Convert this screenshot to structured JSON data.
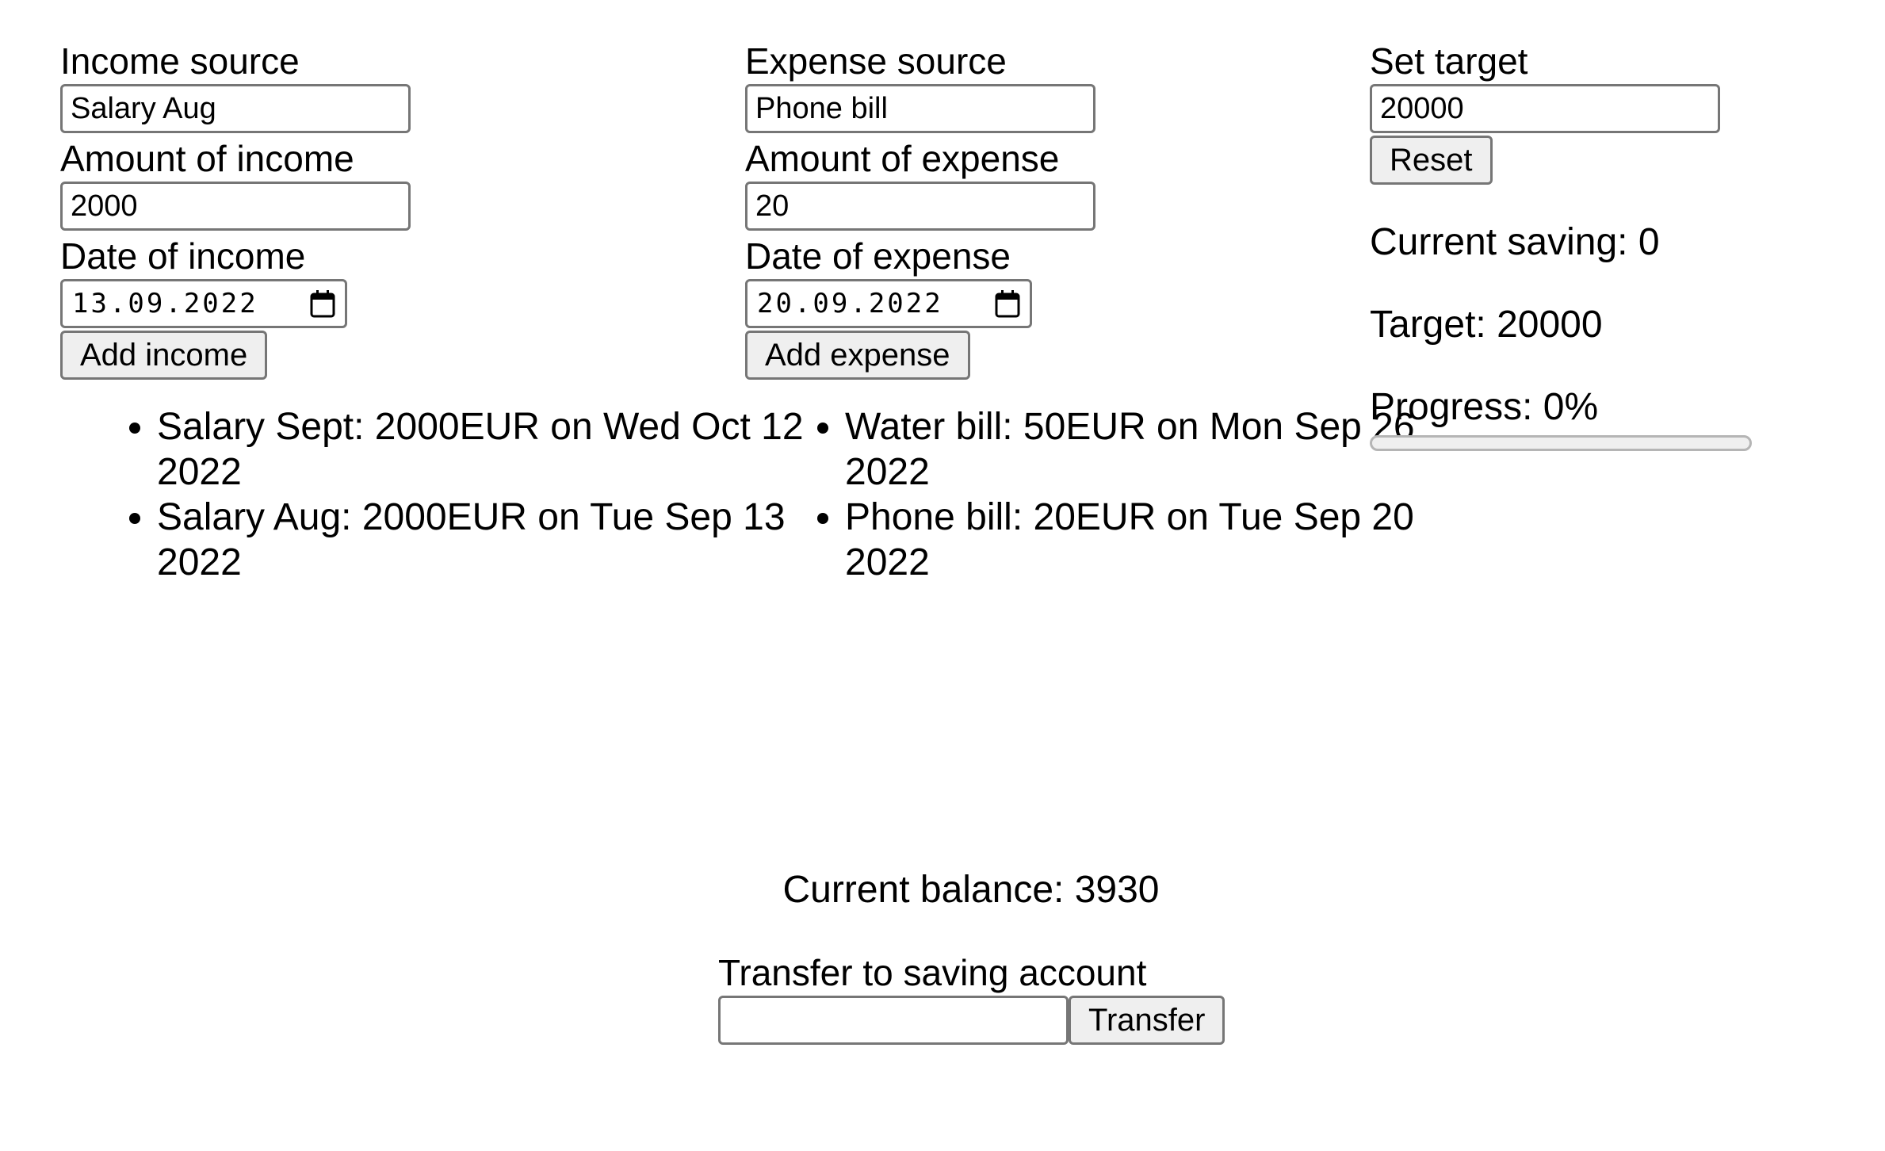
{
  "income": {
    "source_label": "Income source",
    "source_value": "Salary Aug",
    "amount_label": "Amount of income",
    "amount_value": "2000",
    "date_label": "Date of income",
    "date_value": "13.09.2022",
    "add_label": "Add income",
    "entries": [
      "Salary Sept: 2000EUR on Wed Oct 12 2022",
      "Salary Aug: 2000EUR on Tue Sep 13 2022"
    ]
  },
  "expense": {
    "source_label": "Expense source",
    "source_value": "Phone bill",
    "amount_label": "Amount of expense",
    "amount_value": "20",
    "date_label": "Date of expense",
    "date_value": "20.09.2022",
    "add_label": "Add expense",
    "entries": [
      "Water bill: 50EUR on Mon Sep 26 2022",
      "Phone bill: 20EUR on Tue Sep 20 2022"
    ]
  },
  "target": {
    "set_label": "Set target",
    "set_value": "20000",
    "reset_label": "Reset",
    "current_saving": "Current saving: 0",
    "target_text": "Target: 20000",
    "progress_text": "Progress: 0%",
    "progress_percent": 0
  },
  "balance": {
    "text": "Current balance: 3930",
    "transfer_label": "Transfer to saving account",
    "transfer_value": "",
    "transfer_button": "Transfer"
  },
  "icons": {
    "calendar": "calendar-icon"
  }
}
